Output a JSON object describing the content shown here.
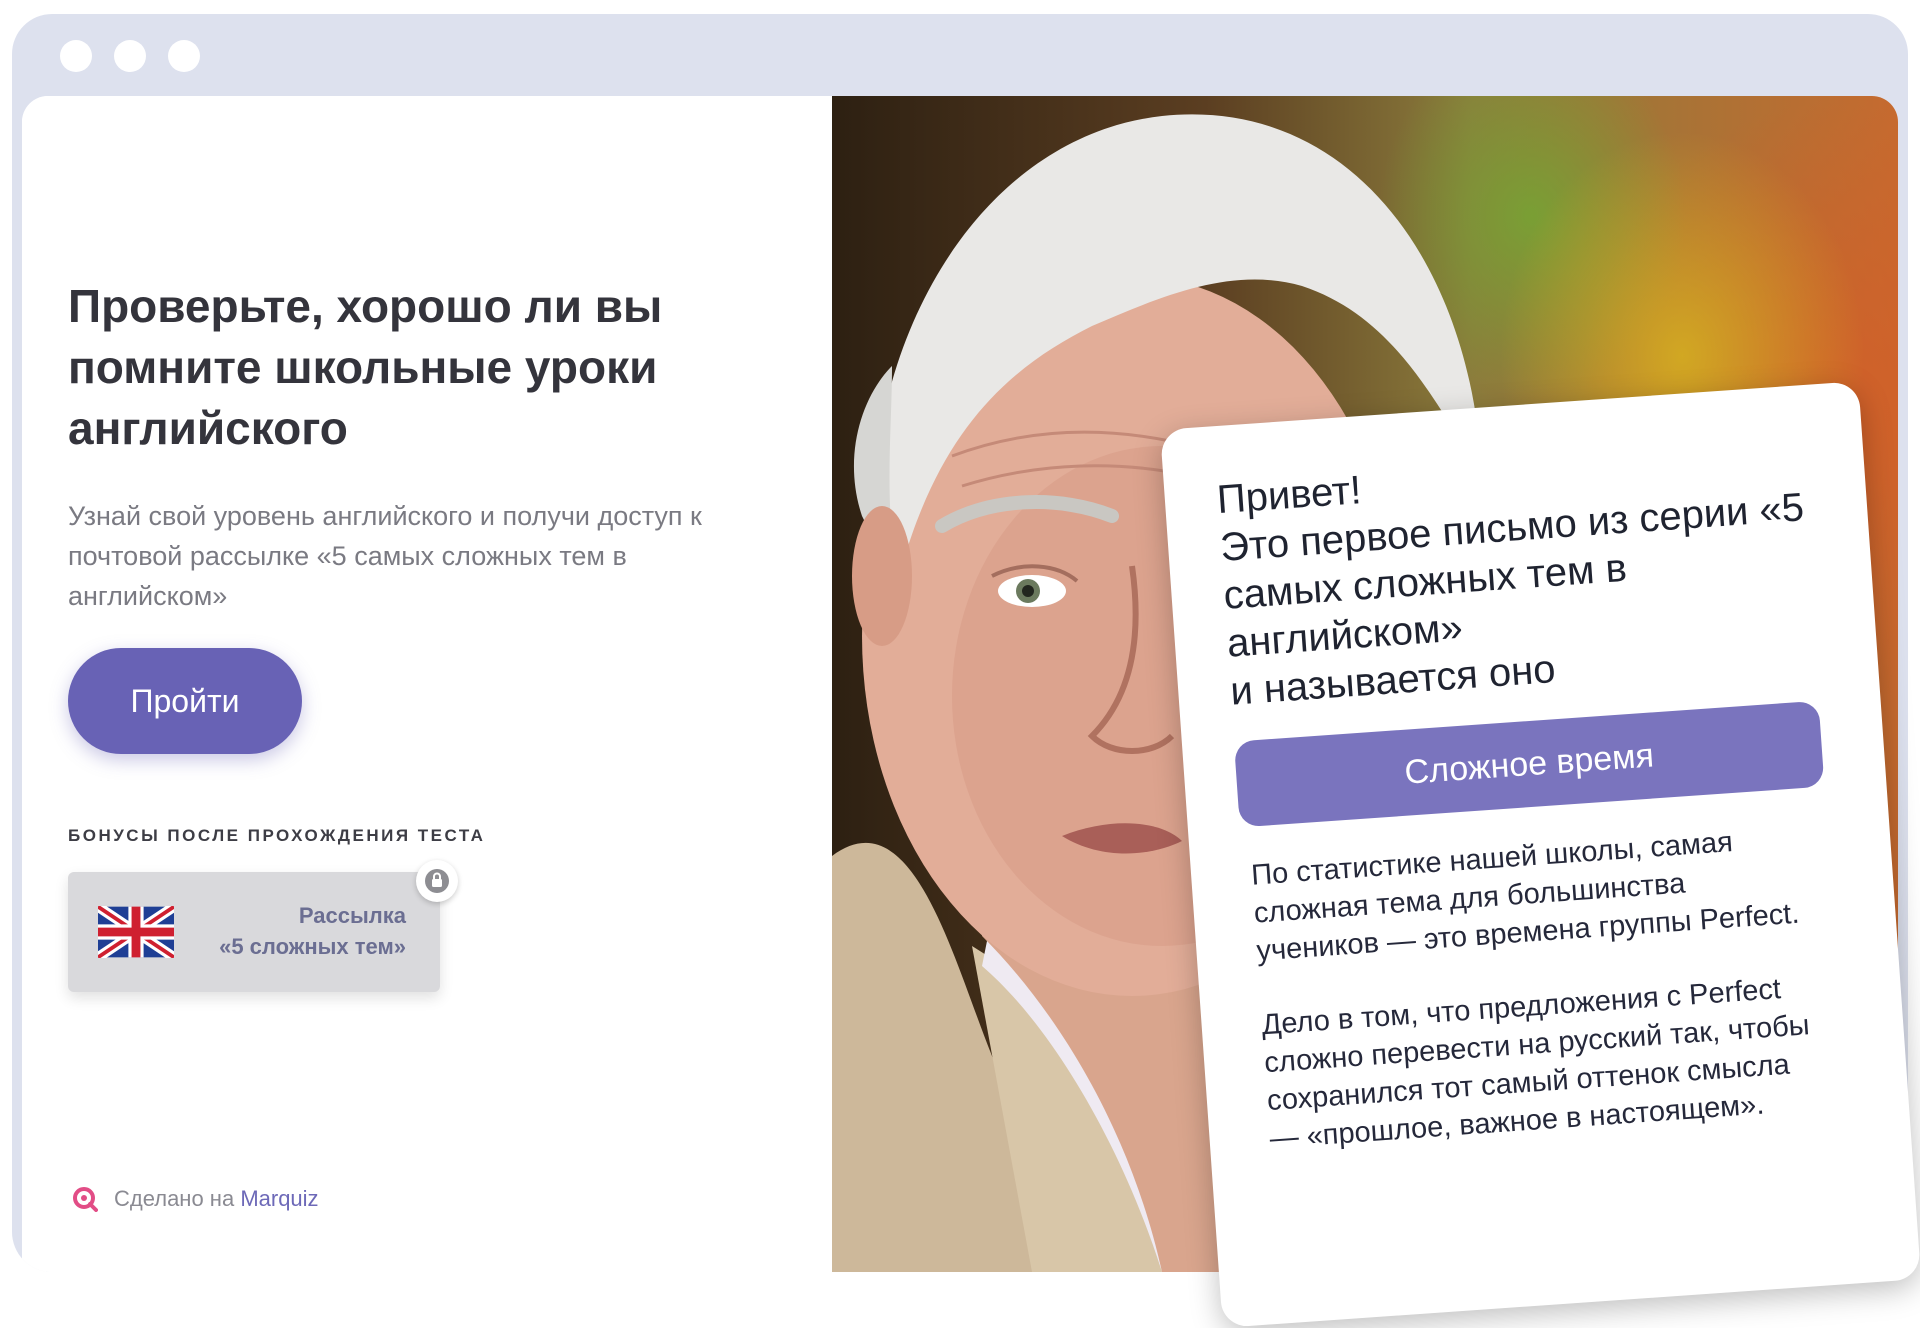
{
  "page": {
    "title": "Проверьте, хорошо ли вы помните школьные уроки английского",
    "subtitle": "Узнай свой уровень английского и получи доступ к почтовой рассылке «5 самых сложных тем в английском»",
    "cta_label": "Пройти",
    "bonus_label": "БОНУСЫ ПОСЛЕ ПРОХОЖДЕНИЯ ТЕСТА",
    "bonus_card": {
      "line1": "Рассылка",
      "line2": "«5 сложных тем»",
      "flag_icon": "uk-flag-icon",
      "lock_icon": "lock-icon"
    },
    "footer": {
      "prefix": "Сделано на",
      "brand": "Marquiz",
      "logo_icon": "marquiz-logo-icon"
    }
  },
  "email_card": {
    "heading": "Привет!\nЭто первое письмо из серии «5 самых сложных тем в английском»\nи называется оно",
    "pill": "Сложное время",
    "para1": "По статистике нашей школы, самая сложная тема для большинства учеников — это времена группы Perfect.",
    "para2": "Дело в том, что предложения с Perfect сложно перевести на русский так, чтобы сохранился тот самый оттенок смысла — «прошлое, важное в настоящем»."
  },
  "colors": {
    "accent": "#6862b5",
    "pill": "#7a74be",
    "frame": "#dde1ee"
  }
}
